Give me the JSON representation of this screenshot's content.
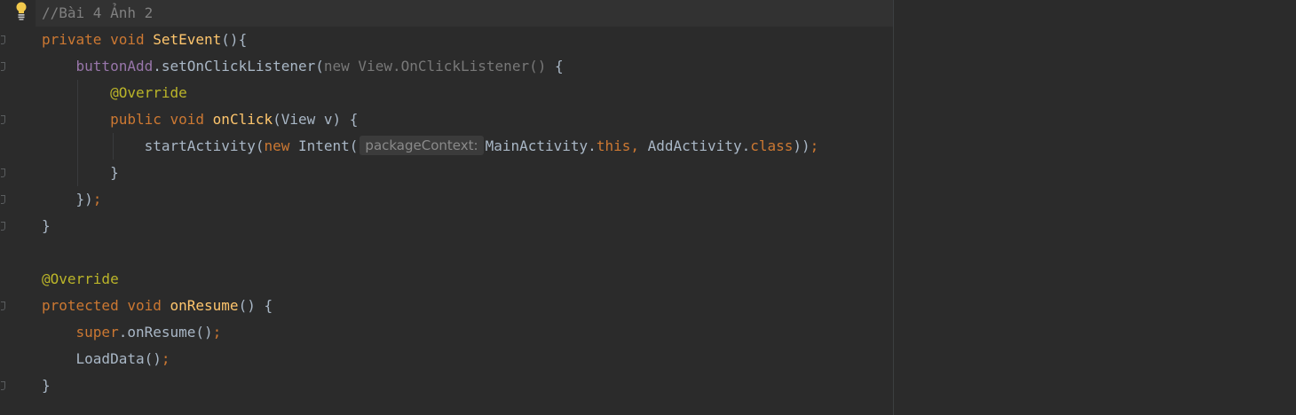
{
  "editor": {
    "lines": [
      {
        "tokens": [
          {
            "t": "//Bài 4 Ảnh 2",
            "c": "comment"
          }
        ]
      },
      {
        "tokens": [
          {
            "t": "private ",
            "c": "kw"
          },
          {
            "t": "void ",
            "c": "kw"
          },
          {
            "t": "SetEvent",
            "c": "fn"
          },
          {
            "t": "(){",
            "c": "plain"
          }
        ]
      },
      {
        "tokens": [
          {
            "t": "    ",
            "c": "plain"
          },
          {
            "t": "buttonAdd",
            "c": "field"
          },
          {
            "t": ".setOnClickListener(",
            "c": "plain"
          },
          {
            "t": "new View.OnClickListener() ",
            "c": "dim"
          },
          {
            "t": "{",
            "c": "plain"
          }
        ]
      },
      {
        "tokens": [
          {
            "t": "        ",
            "c": "plain"
          },
          {
            "t": "@Override",
            "c": "ann"
          }
        ]
      },
      {
        "tokens": [
          {
            "t": "        ",
            "c": "plain"
          },
          {
            "t": "public ",
            "c": "kw"
          },
          {
            "t": "void ",
            "c": "kw"
          },
          {
            "t": "onClick",
            "c": "fn"
          },
          {
            "t": "(View v) {",
            "c": "plain"
          }
        ]
      },
      {
        "tokens": [
          {
            "t": "            ",
            "c": "plain"
          },
          {
            "t": "startActivity(",
            "c": "plain"
          },
          {
            "t": "new ",
            "c": "kw"
          },
          {
            "t": "Intent(",
            "c": "plain"
          },
          {
            "t": "packageContext:",
            "c": "hint"
          },
          {
            "t": "MainActivity.",
            "c": "plain"
          },
          {
            "t": "this",
            "c": "kw"
          },
          {
            "t": ", ",
            "c": "kw"
          },
          {
            "t": "AddActivity.",
            "c": "plain"
          },
          {
            "t": "class",
            "c": "kw"
          },
          {
            "t": "))",
            "c": "plain"
          },
          {
            "t": ";",
            "c": "kw"
          }
        ]
      },
      {
        "tokens": [
          {
            "t": "        ",
            "c": "plain"
          },
          {
            "t": "}",
            "c": "plain"
          }
        ]
      },
      {
        "tokens": [
          {
            "t": "    ",
            "c": "plain"
          },
          {
            "t": "})",
            "c": "plain"
          },
          {
            "t": ";",
            "c": "kw"
          }
        ]
      },
      {
        "tokens": [
          {
            "t": "}",
            "c": "plain"
          }
        ]
      },
      {
        "tokens": []
      },
      {
        "tokens": [
          {
            "t": "@Override",
            "c": "ann"
          }
        ]
      },
      {
        "tokens": [
          {
            "t": "protected ",
            "c": "kw"
          },
          {
            "t": "void ",
            "c": "kw"
          },
          {
            "t": "onResume",
            "c": "fn"
          },
          {
            "t": "() {",
            "c": "plain"
          }
        ]
      },
      {
        "tokens": [
          {
            "t": "    ",
            "c": "plain"
          },
          {
            "t": "super",
            "c": "kw"
          },
          {
            "t": ".onResume()",
            "c": "plain"
          },
          {
            "t": ";",
            "c": "kw"
          }
        ]
      },
      {
        "tokens": [
          {
            "t": "    ",
            "c": "plain"
          },
          {
            "t": "LoadData()",
            "c": "plain"
          },
          {
            "t": ";",
            "c": "kw"
          }
        ]
      },
      {
        "tokens": [
          {
            "t": "}",
            "c": "plain"
          }
        ]
      }
    ]
  },
  "icons": {
    "intention": "lightbulb-icon",
    "fold": "fold-marker-icon"
  },
  "colors": {
    "background": "#2b2b2b",
    "current_line": "#323232",
    "keyword": "#cc7832",
    "function": "#ffc66d",
    "annotation": "#bbb529",
    "field": "#9876aa",
    "comment": "#808080",
    "text": "#a9b7c6",
    "hint_background": "#3b3b3b"
  }
}
